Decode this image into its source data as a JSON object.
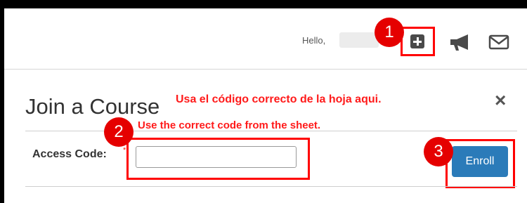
{
  "header": {
    "greeting": "Hello,",
    "icons": [
      "plus-square-icon",
      "megaphone-icon",
      "envelope-icon"
    ]
  },
  "callouts": {
    "badge_1": "1",
    "badge_2": "2",
    "badge_3": "3",
    "note_spanish": "Usa el código correcto de la hoja aqui.",
    "note_english": "Use the correct code from the sheet.",
    "highlight_color": "#ff0000"
  },
  "modal": {
    "title": "Join a Course",
    "close_symbol": "×",
    "access_code_label": "Access Code:",
    "required_marker": "*",
    "access_code_value": "",
    "enroll_label": "Enroll",
    "enroll_color": "#2b7bb9"
  }
}
